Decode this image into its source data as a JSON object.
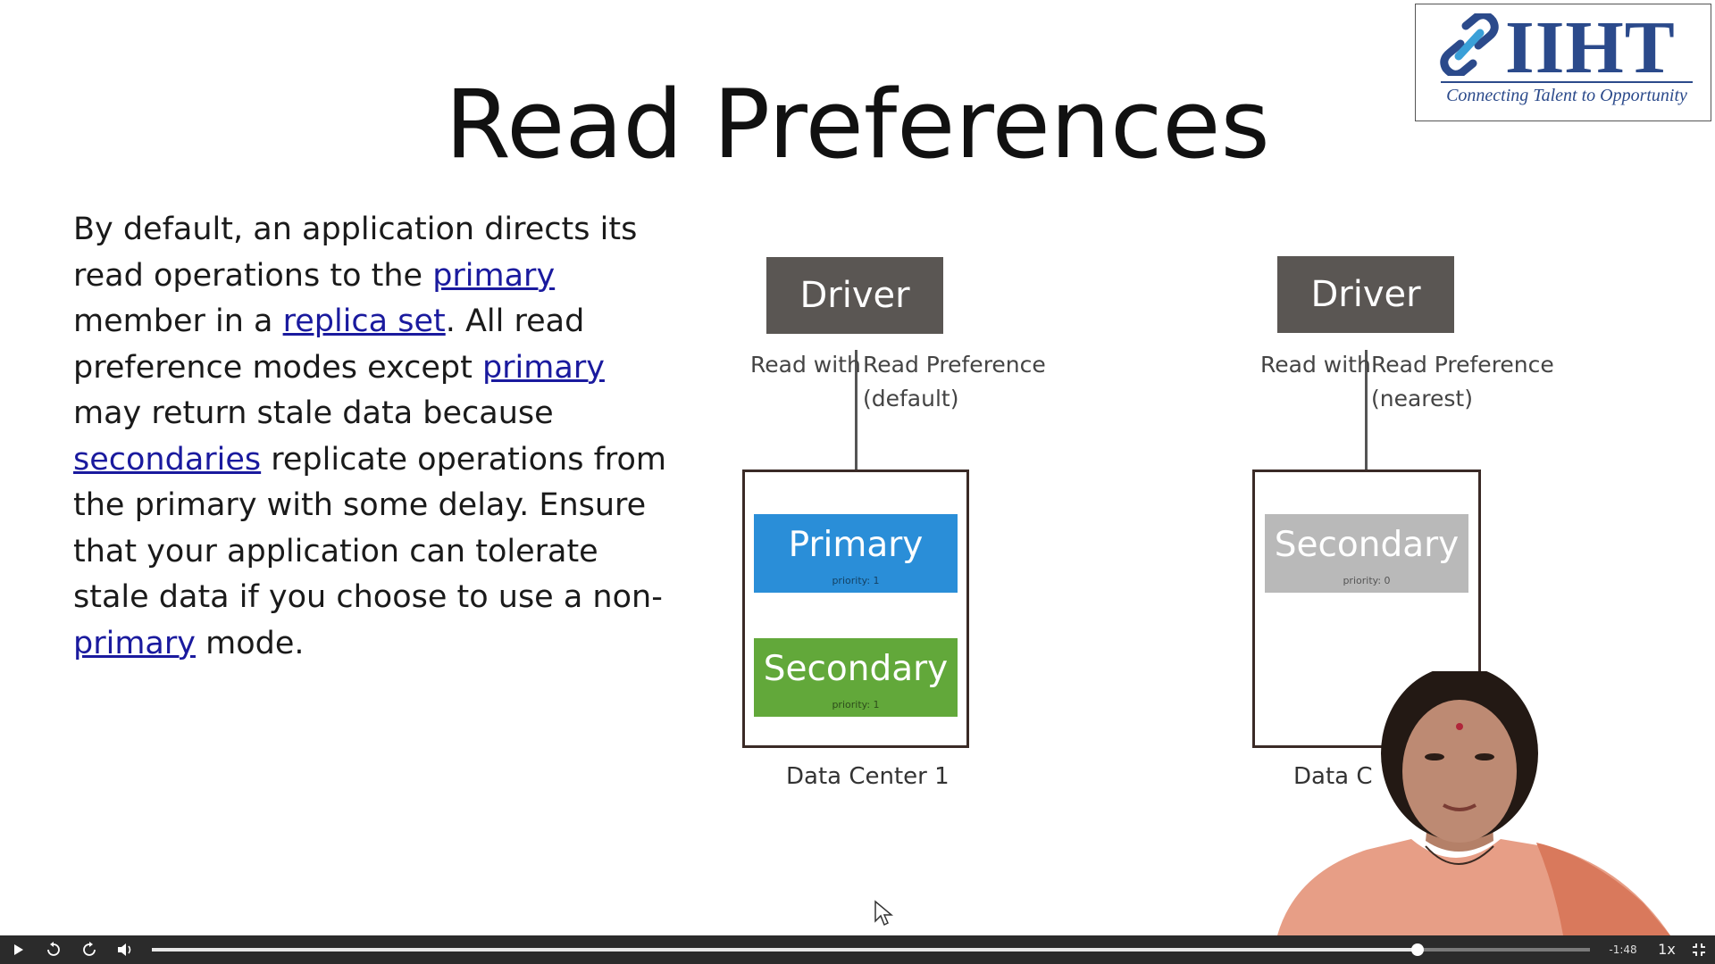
{
  "logo": {
    "brand": "IIHT",
    "tagline": "Connecting Talent to Opportunity",
    "icon": "chain-link-icon",
    "color": "#2b4a8b"
  },
  "slide": {
    "title": "Read Preferences",
    "body": {
      "p1": "By default, an application directs its read operations to the ",
      "link_primary": "primary",
      "p2": " member in a ",
      "link_replica_set": "replica set",
      "p3": ". All read preference modes except ",
      "p4": " may return stale data because ",
      "link_secondaries": "secondaries",
      "p5": " replicate operations from the primary with some delay.  Ensure that your application can tolerate stale data if you choose to use a non-",
      "p6": " mode."
    }
  },
  "diagram": {
    "left": {
      "driver": "Driver",
      "read_with": "Read with",
      "read_pref": "Read Preference",
      "mode": "(default)",
      "members": [
        {
          "name": "Primary",
          "priority": "priority: 1"
        },
        {
          "name": "Secondary",
          "priority": "priority: 1"
        }
      ],
      "data_center": "Data Center 1"
    },
    "right": {
      "driver": "Driver",
      "read_with": "Read with",
      "read_pref": "Read Preference",
      "mode": "(nearest)",
      "members": [
        {
          "name": "Secondary",
          "priority": "priority: 0"
        }
      ],
      "data_center": "Data C"
    },
    "colors": {
      "driver": "#5a5653",
      "primary": "#2a8ed8",
      "secondary": "#62a83a",
      "secondary_priority0": "#b9b9b9"
    }
  },
  "player": {
    "time": "-1:48",
    "speed": "1x",
    "progress": 0.88,
    "icons": [
      "play-icon",
      "rewind-icon",
      "forward-icon",
      "volume-icon",
      "fullscreen-exit-icon"
    ]
  }
}
